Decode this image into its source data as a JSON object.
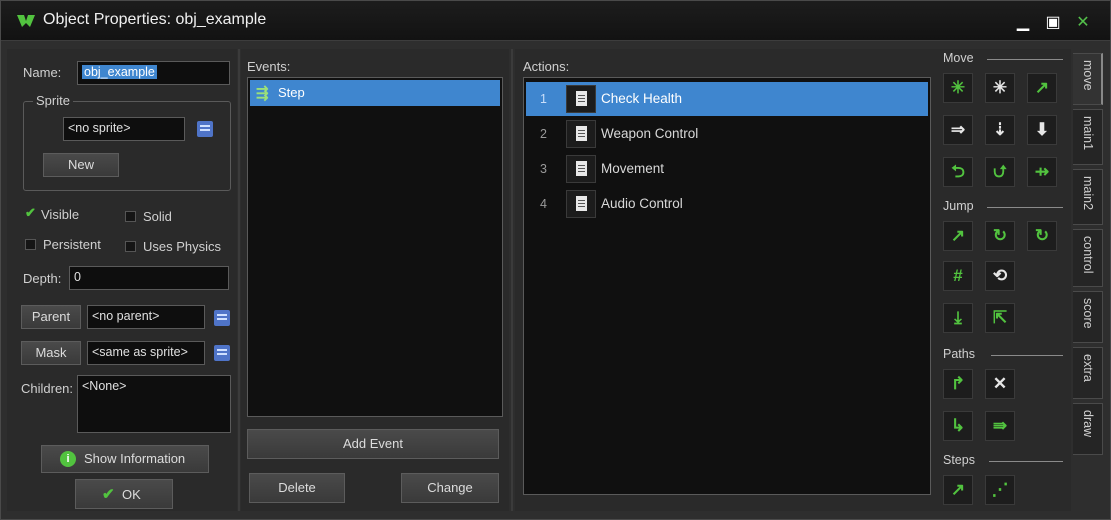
{
  "window": {
    "title": "Object Properties: obj_example",
    "min": "▁",
    "max": "▣",
    "close": "✕"
  },
  "left": {
    "name_label": "Name:",
    "name_value": "obj_example",
    "sprite_group": "Sprite",
    "sprite_value": "<no sprite>",
    "new_button": "New",
    "visible": "Visible",
    "solid": "Solid",
    "persistent": "Persistent",
    "uses_physics": "Uses Physics",
    "depth_label": "Depth:",
    "depth_value": "0",
    "parent_button": "Parent",
    "parent_value": "<no parent>",
    "mask_button": "Mask",
    "mask_value": "<same as sprite>",
    "children_label": "Children:",
    "children_value": "<None>",
    "show_info": "Show Information",
    "ok": "OK",
    "visible_checked": true,
    "solid_checked": false,
    "persistent_checked": false,
    "uses_physics_checked": false
  },
  "events": {
    "header": "Events:",
    "items": [
      "Step"
    ],
    "add_event": "Add Event",
    "delete": "Delete",
    "change": "Change"
  },
  "actions": {
    "header": "Actions:",
    "items": [
      {
        "num": "1",
        "label": "Check Health",
        "selected": true
      },
      {
        "num": "2",
        "label": "Weapon Control",
        "selected": false
      },
      {
        "num": "3",
        "label": "Movement",
        "selected": false
      },
      {
        "num": "4",
        "label": "Audio Control",
        "selected": false
      }
    ]
  },
  "tools": {
    "sections": [
      "Move",
      "Jump",
      "Paths",
      "Steps"
    ]
  },
  "tabs": [
    "move",
    "main1",
    "main2",
    "control",
    "score",
    "extra",
    "draw"
  ],
  "colors": {
    "accent": "#3f86cf",
    "green": "#52c33f"
  }
}
